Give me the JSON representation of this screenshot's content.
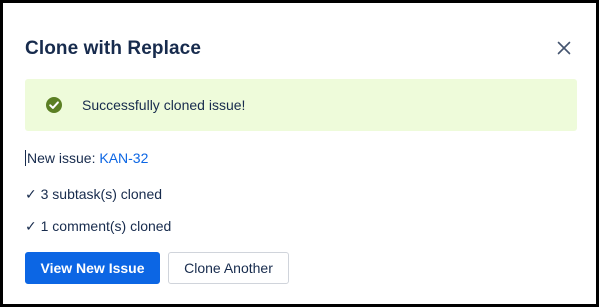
{
  "dialog": {
    "title": "Clone with Replace",
    "close_icon": "close-icon"
  },
  "banner": {
    "icon": "check-circle-icon",
    "message": "Successfully cloned issue!",
    "colors": {
      "background": "#eefbda",
      "icon": "#5b7f24"
    }
  },
  "result": {
    "new_issue_label": "New issue:",
    "new_issue_key": "KAN-32",
    "subtasks_line": "✓ 3 subtask(s) cloned",
    "comments_line": "✓ 1 comment(s) cloned"
  },
  "actions": {
    "primary_label": "View New Issue",
    "secondary_label": "Clone Another"
  },
  "colors": {
    "accent": "#0c66e4",
    "text": "#172b4d"
  }
}
